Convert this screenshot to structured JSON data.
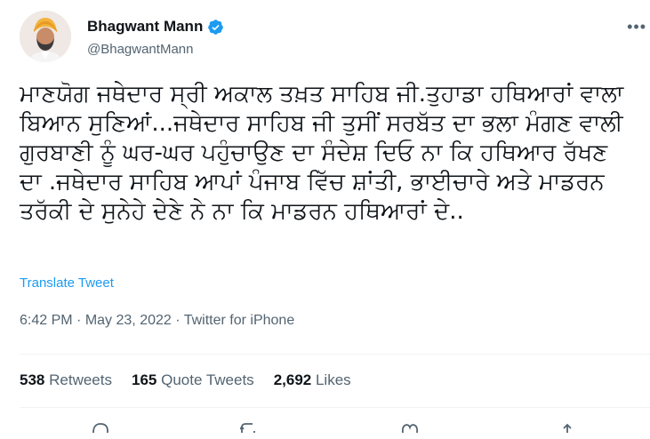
{
  "user": {
    "name": "Bhagwant Mann",
    "handle": "@BhagwantMann",
    "verified": true
  },
  "tweet": {
    "text": "ਮਾਣਯੋਗ ਜਥੇਦਾਰ ਸ੍ਰੀ ਅਕਾਲ ਤਖ਼ਤ ਸਾਹਿਬ ਜੀ.ਤੁਹਾਡਾ ਹਥਿਆਰਾਂ ਵਾਲਾ ਬਿਆਨ ਸੁਣਿਆਂ...ਜਥੇਦਾਰ ਸਾਹਿਬ ਜੀ ਤੁਸੀਂ ਸਰਬੱਤ ਦਾ ਭਲਾ ਮੰਗਣ ਵਾਲੀ ਗੁਰਬਾਣੀ ਨੂੰ ਘਰ-ਘਰ ਪਹੁੰਚਾਉਣ ਦਾ ਸੰਦੇਸ਼ ਦਿਓ ਨਾ ਕਿ ਹਥਿਆਰ ਰੱਖਣ ਦਾ .ਜਥੇਦਾਰ ਸਾਹਿਬ ਆਪਾਂ ਪੰਜਾਬ ਵਿੱਚ ਸ਼ਾਂਤੀ, ਭਾਈਚਾਰੇ ਅਤੇ ਮਾਡਰਨ ਤਰੱਕੀ ਦੇ ਸੁਨੇਹੇ ਦੇਣੇ ਨੇ ਨਾ ਕਿ ਮਾਡਰਨ ਹਥਿਆਰਾਂ ਦੇ..",
    "translate_label": "Translate Tweet",
    "time": "6:42 PM",
    "date": "May 23, 2022",
    "source": "Twitter for iPhone",
    "separator": "·"
  },
  "stats": {
    "retweets_count": "538",
    "retweets_label": "Retweets",
    "quotes_count": "165",
    "quotes_label": "Quote Tweets",
    "likes_count": "2,692",
    "likes_label": "Likes"
  },
  "icons": {
    "verified": "verified-badge-icon",
    "more": "more-options-icon",
    "reply": "reply-icon",
    "retweet": "retweet-icon",
    "like": "like-icon",
    "share": "share-icon"
  },
  "colors": {
    "accent": "#1d9bf0",
    "text": "#0f1419",
    "secondary": "#536471",
    "divider": "#eff3f4"
  }
}
